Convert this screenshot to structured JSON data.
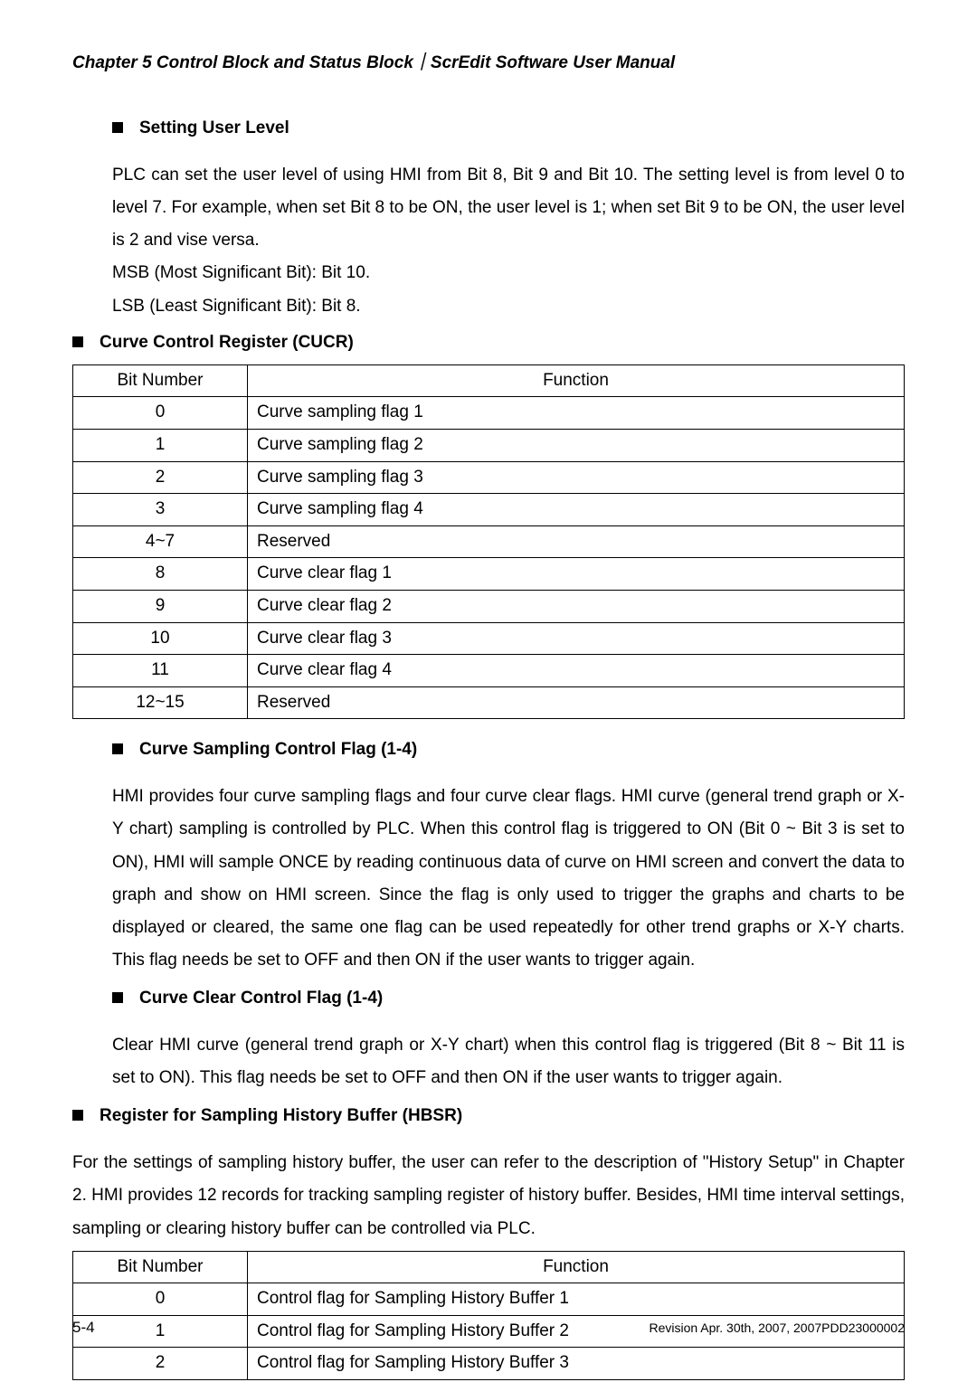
{
  "header": {
    "running": "Chapter 5  Control Block and Status Block｜ScrEdit Software User Manual"
  },
  "sections": {
    "settingUserLevel": {
      "title": "Setting User Level",
      "p1": "PLC can set the user level of using HMI from Bit 8, Bit 9 and Bit 10. The setting level is from level 0 to level 7. For example, when set Bit 8 to be ON, the user level is 1; when set Bit 9 to be ON, the user level is 2 and vise versa.",
      "p2": "MSB (Most Significant Bit): Bit 10.",
      "p3": "LSB (Least Significant Bit): Bit 8."
    },
    "cucr": {
      "title": "Curve Control Register (CUCR)",
      "headers": {
        "bit": "Bit Number",
        "func": "Function"
      },
      "rows": [
        {
          "bit": "0",
          "func": "Curve sampling flag 1"
        },
        {
          "bit": "1",
          "func": "Curve sampling flag 2"
        },
        {
          "bit": "2",
          "func": "Curve sampling flag 3"
        },
        {
          "bit": "3",
          "func": "Curve sampling flag 4"
        },
        {
          "bit": "4~7",
          "func": "Reserved"
        },
        {
          "bit": "8",
          "func": "Curve clear flag 1"
        },
        {
          "bit": "9",
          "func": "Curve clear flag 2"
        },
        {
          "bit": "10",
          "func": "Curve clear flag 3"
        },
        {
          "bit": "11",
          "func": "Curve clear flag 4"
        },
        {
          "bit": "12~15",
          "func": "Reserved"
        }
      ]
    },
    "curveSampling": {
      "title": "Curve Sampling Control Flag (1-4)",
      "p": "HMI provides four curve sampling flags and four curve clear flags. HMI curve (general trend graph or X-Y chart) sampling is controlled by PLC. When this control flag is triggered to ON (Bit 0 ~ Bit 3 is set to ON), HMI will sample ONCE by reading continuous data of curve on HMI screen and convert the data to graph and show on HMI screen. Since the flag is only used to trigger the graphs and charts to be displayed or cleared, the same one flag can be used repeatedly for other trend graphs or X-Y charts. This flag needs be set to OFF and then ON if the user wants to trigger again."
    },
    "curveClear": {
      "title": "Curve Clear Control Flag (1-4)",
      "p": "Clear HMI curve (general trend graph or X-Y chart) when this control flag is triggered (Bit 8 ~ Bit 11 is set to ON). This flag needs be set to OFF and then ON if the user wants to trigger again."
    },
    "hbsr": {
      "title": "Register for Sampling History Buffer (HBSR)",
      "p": "For the settings of sampling history buffer, the user can refer to the description of \"History Setup\" in Chapter 2. HMI provides 12 records for tracking sampling register of history buffer. Besides, HMI time interval settings, sampling or clearing history buffer can be controlled via PLC.",
      "headers": {
        "bit": "Bit Number",
        "func": "Function"
      },
      "rows": [
        {
          "bit": "0",
          "func": "Control flag for Sampling History Buffer 1"
        },
        {
          "bit": "1",
          "func": "Control flag for Sampling History Buffer 2"
        },
        {
          "bit": "2",
          "func": "Control flag for Sampling History Buffer 3"
        }
      ]
    }
  },
  "footer": {
    "page": "5-4",
    "revision": "Revision Apr. 30th, 2007, 2007PDD23000002"
  }
}
